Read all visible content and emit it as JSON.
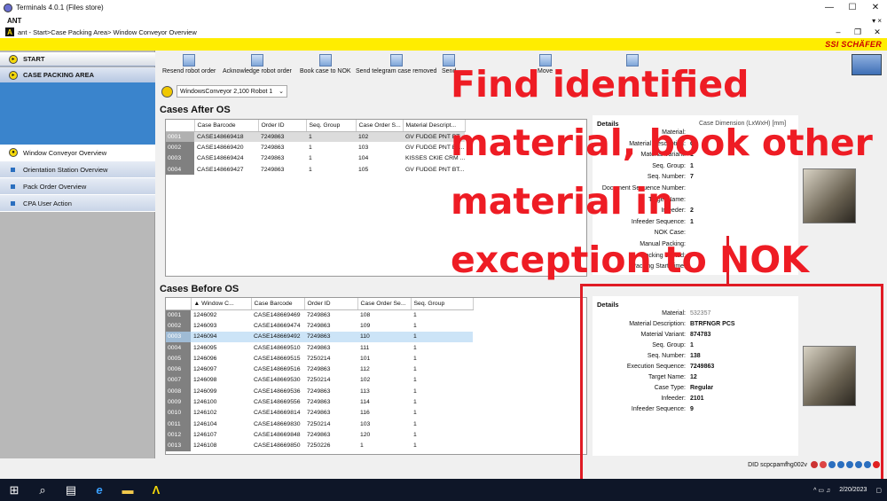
{
  "window": {
    "title": "Terminals 4.0.1 (Files store)",
    "minimize": "—",
    "maximize": "☐",
    "close": "✕"
  },
  "inner": {
    "name": "ANT",
    "path": "ant - Start>Case Packing Area> Window Conveyor Overview",
    "logo": "A"
  },
  "brand": {
    "name": "SSI SCHÄFER"
  },
  "sidebar": {
    "start": "START",
    "case_packing": "CASE PACKING AREA",
    "items": [
      {
        "label": "Window Conveyor Overview"
      },
      {
        "label": "Orientation Station Overview"
      },
      {
        "label": "Pack Order Overview"
      },
      {
        "label": "CPA User Action"
      }
    ]
  },
  "toolbar": {
    "buttons": [
      {
        "label": "Resend robot order"
      },
      {
        "label": "Acknowledge robot order"
      },
      {
        "label": "Book case to NOK"
      },
      {
        "label": "Send telegram case removed"
      },
      {
        "label": "Send"
      },
      {
        "label": "Move"
      }
    ]
  },
  "conveyor_select": {
    "value": "WindowsConveyor 2,100 Robot 1"
  },
  "cases_after": {
    "title": "Cases After OS",
    "headers": [
      "Case Barcode",
      "Order ID",
      "Seq. Group",
      "Case Order S...",
      "Material Descript..."
    ],
    "rows": [
      [
        "0001",
        "CASE148669418",
        "7249863",
        "1",
        "102",
        "GV FUDGE PNT BT..."
      ],
      [
        "0002",
        "CASE148669420",
        "7249863",
        "1",
        "103",
        "GV FUDGE PNT BT..."
      ],
      [
        "0003",
        "CASE148669424",
        "7249863",
        "1",
        "104",
        "KISSES CKIE CRM ..."
      ],
      [
        "0004",
        "CASE148669427",
        "7249863",
        "1",
        "105",
        "GV FUDGE PNT BT..."
      ]
    ]
  },
  "cases_before": {
    "title": "Cases Before OS",
    "headers": [
      "Window C...",
      "Case Barcode",
      "Order ID",
      "Case Order Se...",
      "Seq. Group"
    ],
    "rows": [
      [
        "0001",
        "1246092",
        "CASE148669469",
        "7249863",
        "108",
        "1"
      ],
      [
        "0002",
        "1246093",
        "CASE148669474",
        "7249863",
        "109",
        "1"
      ],
      [
        "0003",
        "1246094",
        "CASE148669492",
        "7249863",
        "110",
        "1"
      ],
      [
        "0004",
        "1246095",
        "CASE148669510",
        "7249863",
        "111",
        "1"
      ],
      [
        "0005",
        "1246096",
        "CASE148669515",
        "7250214",
        "101",
        "1"
      ],
      [
        "0006",
        "1246097",
        "CASE148669516",
        "7249863",
        "112",
        "1"
      ],
      [
        "0007",
        "1246098",
        "CASE148669530",
        "7250214",
        "102",
        "1"
      ],
      [
        "0008",
        "1246099",
        "CASE148669536",
        "7249863",
        "113",
        "1"
      ],
      [
        "0009",
        "1246100",
        "CASE148669556",
        "7249863",
        "114",
        "1"
      ],
      [
        "0010",
        "1246102",
        "CASE148669814",
        "7249863",
        "116",
        "1"
      ],
      [
        "0011",
        "1246104",
        "CASE148669830",
        "7250214",
        "103",
        "1"
      ],
      [
        "0012",
        "1246107",
        "CASE148669848",
        "7249863",
        "120",
        "1"
      ],
      [
        "0013",
        "1246108",
        "CASE148669850",
        "7250226",
        "1",
        "1"
      ]
    ]
  },
  "details_top": {
    "title": "Details",
    "extra": "Case Dimension (LxWxH) [mm]",
    "rows": [
      {
        "k": "Material:",
        "v": ""
      },
      {
        "k": "Material Description:",
        "v": "G"
      },
      {
        "k": "Material Variant:",
        "v": "1"
      },
      {
        "k": "Seq. Group:",
        "v": "1"
      },
      {
        "k": "Seq. Number:",
        "v": "7"
      },
      {
        "k": "Document Sequence Number:",
        "v": ""
      },
      {
        "k": "Target Name:",
        "v": ""
      },
      {
        "k": "Infeeder:",
        "v": "2"
      },
      {
        "k": "Infeeder Sequence:",
        "v": "1"
      },
      {
        "k": "NOK Case:",
        "v": ""
      },
      {
        "k": "Manual Packing:",
        "v": ""
      },
      {
        "k": "Packing started:",
        "v": ""
      },
      {
        "k": "Packing Start Time:",
        "v": ""
      }
    ]
  },
  "details_bottom": {
    "title": "Details",
    "rows": [
      {
        "k": "Material:",
        "v": "532357"
      },
      {
        "k": "Material Description:",
        "v": "BTRFNGR PCS"
      },
      {
        "k": "Material Variant:",
        "v": "874783"
      },
      {
        "k": "Seq. Group:",
        "v": "1"
      },
      {
        "k": "Seq. Number:",
        "v": "138"
      },
      {
        "k": "Execution Sequence:",
        "v": "7249863"
      },
      {
        "k": "Target Name:",
        "v": "12"
      },
      {
        "k": "Case Type:",
        "v": "Regular"
      },
      {
        "k": "Infeeder:",
        "v": "2101"
      },
      {
        "k": "Infeeder Sequence:",
        "v": "9"
      }
    ]
  },
  "annotation": {
    "text": "Find identified material, book other material in exception to NOK"
  },
  "status": {
    "did": "DID scpcpamfhg002v"
  },
  "taskbar": {
    "date": "2/20/2023",
    "time": ""
  },
  "colors": {
    "accent_yellow": "#ffed00",
    "annotation_red": "#ee1c24",
    "sidebar_blue": "#3a84cc"
  }
}
